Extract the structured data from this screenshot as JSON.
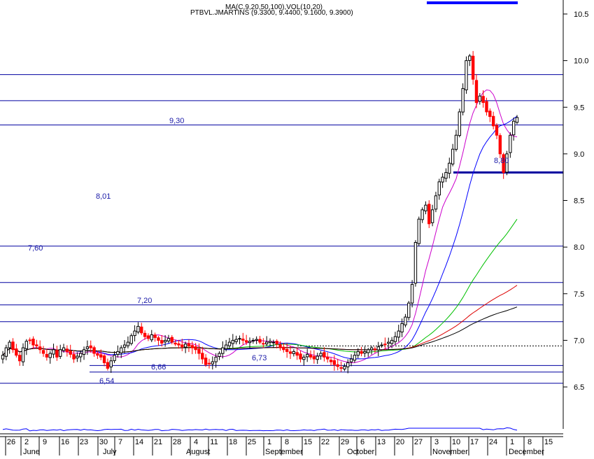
{
  "header": {
    "ma_text": "MA(C,9,20,50,100),VOL(10,20)",
    "ticker_text": "PTBVL.JMARTINS (9.3300, 9.4400, 9.1600, 9.3900)"
  },
  "colors": {
    "background": "#ffffff",
    "hline": "#0000a0",
    "annotation": "#1a1aa8",
    "up_candle": "#000000",
    "down_candle": "#ff0000",
    "ma9": "#cc00cc",
    "ma20": "#0000ff",
    "ma50": "#00c000",
    "ma100": "#dd0000",
    "ma200": "#000000",
    "volume": "#0000ff"
  },
  "chart_data": {
    "type": "candlestick",
    "title": "PTBVL.JMARTINS (9.3300, 9.4400, 9.1600, 9.3900)",
    "subtitle": "MA(C,9,20,50,100),VOL(10,20)",
    "ylim": [
      6.05,
      10.65
    ],
    "y_ticks": [
      "10.5",
      "10.0",
      "9.5",
      "9.0",
      "8.5",
      "8.0",
      "7.5",
      "7.0",
      "6.5"
    ],
    "x_ticks": [
      "26",
      "2",
      "9",
      "16",
      "23",
      "30",
      "7",
      "14",
      "21",
      "28",
      "4",
      "11",
      "18",
      "25",
      "1",
      "8",
      "15",
      "22",
      "29",
      "6",
      "13",
      "20",
      "27",
      "3",
      "10",
      "17",
      "24",
      "1",
      "8",
      "15"
    ],
    "months": [
      "June",
      "July",
      "August",
      "September",
      "October",
      "November",
      "December"
    ],
    "last_ohlc": {
      "open": 9.33,
      "high": 9.44,
      "low": 9.16,
      "close": 9.39
    },
    "horizontal_levels": [
      9.85,
      9.57,
      9.31,
      8.8,
      8.01,
      7.62,
      7.38,
      7.2,
      6.73,
      6.66,
      6.54
    ],
    "dotted_level": 6.94,
    "annotations": [
      {
        "text": "9,30",
        "value": 9.3
      },
      {
        "text": "8,01",
        "value": 8.01
      },
      {
        "text": "7,60",
        "value": 7.6
      },
      {
        "text": "7,20",
        "value": 7.2
      },
      {
        "text": "8,80",
        "value": 8.8
      },
      {
        "text": "6,66",
        "value": 6.66
      },
      {
        "text": "6,73",
        "value": 6.73
      },
      {
        "text": "6,54",
        "value": 6.54
      }
    ],
    "close_series": [
      6.84,
      6.92,
      6.98,
      6.9,
      6.84,
      6.78,
      6.92,
      6.99,
      7.0,
      6.95,
      6.94,
      6.9,
      6.86,
      6.82,
      6.86,
      6.9,
      6.82,
      6.9,
      6.92,
      6.88,
      6.85,
      6.8,
      6.83,
      6.86,
      6.9,
      6.93,
      6.92,
      6.86,
      6.84,
      6.82,
      6.76,
      6.7,
      6.78,
      6.84,
      6.88,
      6.92,
      6.95,
      6.98,
      7.05,
      7.1,
      7.15,
      7.08,
      7.04,
      7.02,
      7.06,
      7.03,
      7.0,
      6.97,
      7.0,
      7.02,
      6.98,
      6.96,
      6.95,
      6.93,
      6.96,
      6.94,
      6.92,
      6.9,
      6.86,
      6.8,
      6.74,
      6.75,
      6.77,
      6.82,
      6.86,
      6.92,
      6.95,
      6.98,
      7.0,
      7.01,
      7.02,
      7.0,
      6.98,
      6.99,
      7.0,
      7.01,
      6.98,
      6.96,
      6.98,
      6.99,
      6.98,
      6.96,
      6.92,
      6.9,
      6.88,
      6.86,
      6.88,
      6.84,
      6.8,
      6.82,
      6.85,
      6.82,
      6.8,
      6.83,
      6.86,
      6.82,
      6.8,
      6.77,
      6.74,
      6.72,
      6.7,
      6.72,
      6.76,
      6.8,
      6.84,
      6.88,
      6.86,
      6.88,
      6.9,
      6.92,
      6.9,
      6.93,
      6.95,
      6.96,
      6.98,
      7.0,
      7.04,
      7.1,
      7.18,
      7.25,
      7.4,
      7.6,
      8.05,
      8.3,
      8.4,
      8.45,
      8.25,
      8.4,
      8.55,
      8.7,
      8.75,
      8.8,
      8.9,
      9.05,
      9.2,
      9.45,
      9.7,
      10.0,
      10.05,
      9.8,
      9.55,
      9.62,
      9.55,
      9.45,
      9.4,
      9.3,
      9.2,
      9.0,
      8.8,
      9.0,
      9.2,
      9.35,
      9.39
    ]
  }
}
